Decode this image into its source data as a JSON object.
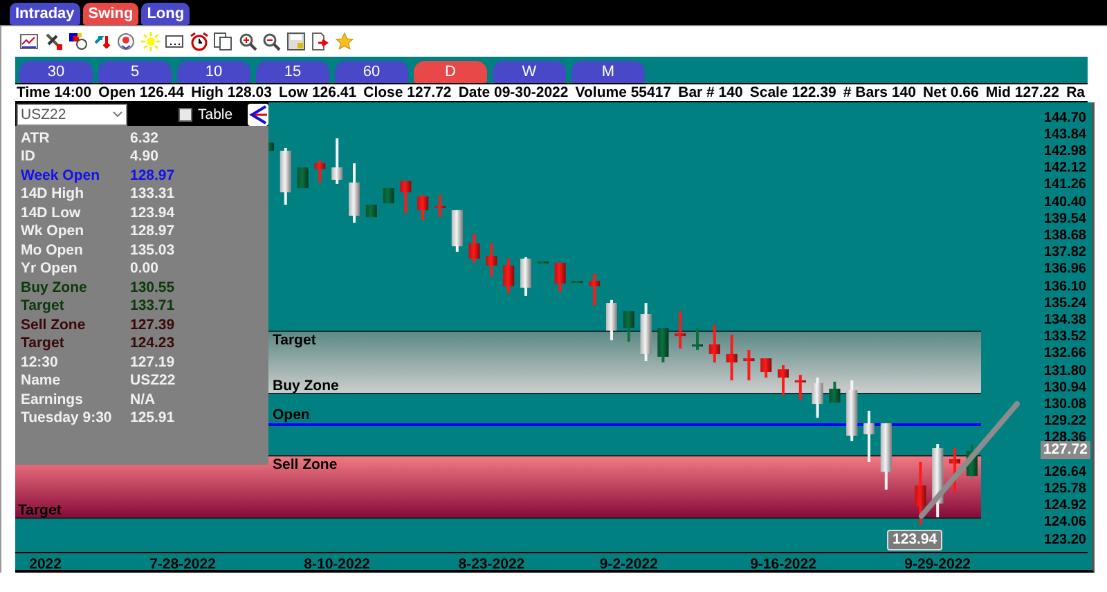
{
  "mode_tabs": [
    {
      "label": "Intraday",
      "selected": false
    },
    {
      "label": "Swing",
      "selected": true
    },
    {
      "label": "Long",
      "selected": false
    }
  ],
  "timeframes": [
    {
      "label": "30",
      "selected": false
    },
    {
      "label": "5",
      "selected": false
    },
    {
      "label": "10",
      "selected": false
    },
    {
      "label": "15",
      "selected": false
    },
    {
      "label": "60",
      "selected": false
    },
    {
      "label": "D",
      "selected": true
    },
    {
      "label": "W",
      "selected": false
    },
    {
      "label": "M",
      "selected": false
    }
  ],
  "info_bar": [
    "Time 14:00",
    "Open 126.44",
    "High 128.03",
    "Low 126.41",
    "Close 127.72",
    "Date 09-30-2022",
    "Volume 55417",
    "Bar # 140",
    "Scale 122.39",
    "# Bars 140",
    "Net 0.66",
    "Mid 127.22",
    "Ra"
  ],
  "symbol_select": {
    "value": "USZ22"
  },
  "table_toggle": {
    "label": "Table",
    "checked": false
  },
  "stats": [
    {
      "label": "ATR",
      "value": "6.32",
      "color": "#f0f0f0"
    },
    {
      "label": "ID",
      "value": "4.90",
      "color": "#f0f0f0"
    },
    {
      "label": "Week Open",
      "value": "128.97",
      "color": "#1010f0"
    },
    {
      "label": "14D High",
      "value": "133.31",
      "color": "#f0f0f0"
    },
    {
      "label": "14D Low",
      "value": "123.94",
      "color": "#f0f0f0"
    },
    {
      "label": "Wk Open",
      "value": "128.97",
      "color": "#f0f0f0"
    },
    {
      "label": "Mo Open",
      "value": "135.03",
      "color": "#f0f0f0"
    },
    {
      "label": "Yr Open",
      "value": "0.00",
      "color": "#f0f0f0"
    },
    {
      "label": "Buy Zone",
      "value": "130.55",
      "color": "#0a3a0a"
    },
    {
      "label": "Target",
      "value": "133.71",
      "color": "#0a3a0a"
    },
    {
      "label": "Sell Zone",
      "value": "127.39",
      "color": "#3a0808"
    },
    {
      "label": "Target",
      "value": "124.23",
      "color": "#3a0808"
    },
    {
      "label": "12:30",
      "value": "127.19",
      "color": "#f0f0f0"
    },
    {
      "label": "Name",
      "value": "USZ22",
      "color": "#f0f0f0"
    },
    {
      "label": "Earnings",
      "value": "N/A",
      "color": "#f0f0f0"
    },
    {
      "label": "Tuesday 9:30",
      "value": "125.91",
      "color": "#f0f0f0"
    }
  ],
  "chart": {
    "bands": [
      {
        "kind": "buy",
        "top_label": "Target",
        "bottom_label": "Buy Zone"
      },
      {
        "kind": "sell",
        "top_label": "Sell Zone",
        "bottom_label": "Target"
      }
    ],
    "open_line": {
      "label": "Open"
    },
    "current_price": "127.72",
    "low_tag": "123.94",
    "chart_data": {
      "type": "candlestick",
      "categories": [
        null,
        null,
        "2022",
        null,
        null,
        null,
        null,
        null,
        null,
        null,
        "7-28-2022",
        null,
        null,
        null,
        null,
        null,
        null,
        null,
        null,
        "8-10-2022",
        null,
        null,
        null,
        null,
        null,
        null,
        null,
        null,
        "8-23-2022",
        null,
        null,
        null,
        null,
        null,
        null,
        null,
        "9-2-2022",
        null,
        null,
        null,
        null,
        null,
        null,
        null,
        null,
        "9-16-2022",
        null,
        null,
        null,
        null,
        null,
        null,
        null,
        null,
        "9-29-2022",
        null,
        null,
        null,
        null,
        null
      ],
      "series": [
        {
          "color": "#0a7040",
          "ohlc": [
            null,
            null,
            null,
            null,
            null,
            null,
            null,
            null,
            null,
            null,
            null,
            null,
            null,
            null,
            null,
            [
              143.01,
              143.43,
              143.01,
              143.43
            ],
            null,
            [
              141.1,
              142.16,
              141.1,
              142.16
            ],
            null,
            null,
            null,
            [
              139.62,
              140.26,
              139.62,
              140.26
            ],
            [
              140.33,
              141.1,
              140.33,
              141.1
            ],
            null,
            null,
            null,
            null,
            null,
            null,
            null,
            null,
            [
              137.3,
              137.37,
              137.3,
              137.37
            ],
            null,
            [
              136.31,
              136.38,
              136.31,
              136.38
            ],
            null,
            null,
            [
              133.98,
              134.83,
              133.28,
              134.83
            ],
            null,
            [
              132.51,
              133.98,
              132.22,
              133.98
            ],
            null,
            [
              133.07,
              133.98,
              132.86,
              133.14
            ],
            null,
            null,
            null,
            null,
            null,
            null,
            null,
            [
              130.18,
              131.24,
              130.18,
              130.88
            ],
            null,
            null,
            null,
            null,
            null,
            null,
            null,
            [
              126.44,
              128.03,
              126.41,
              127.72
            ],
            null,
            null,
            null
          ]
        },
        {
          "color": "#f4f4f4",
          "ohlc": [
            null,
            null,
            null,
            null,
            null,
            null,
            null,
            null,
            null,
            null,
            null,
            null,
            null,
            null,
            null,
            null,
            [
              140.89,
              143.15,
              140.26,
              143.01
            ],
            null,
            null,
            [
              141.53,
              143.64,
              141.32,
              142.16
            ],
            [
              139.7,
              142.37,
              139.34,
              141.39
            ],
            null,
            null,
            null,
            null,
            null,
            [
              138.14,
              139.98,
              137.86,
              139.98
            ],
            null,
            null,
            null,
            [
              136.03,
              137.58,
              135.61,
              137.51
            ],
            null,
            null,
            null,
            null,
            [
              133.84,
              135.4,
              133.35,
              135.25
            ],
            null,
            [
              132.65,
              135.25,
              132.29,
              134.69
            ],
            null,
            null,
            null,
            null,
            null,
            null,
            null,
            null,
            null,
            [
              130.11,
              131.45,
              129.4,
              131.17
            ],
            null,
            [
              128.49,
              131.31,
              128.21,
              130.81
            ],
            [
              128.56,
              129.76,
              127.15,
              129.12
            ],
            [
              126.65,
              129.12,
              125.74,
              129.12
            ],
            null,
            null,
            [
              125.03,
              128.06,
              124.33,
              127.85
            ],
            null,
            null,
            null,
            null,
            null
          ]
        },
        {
          "color": "#ff1a1a",
          "ohlc": [
            null,
            null,
            null,
            null,
            null,
            null,
            null,
            null,
            null,
            null,
            null,
            null,
            null,
            null,
            null,
            null,
            null,
            null,
            [
              142.37,
              142.51,
              141.39,
              142.09
            ],
            null,
            null,
            null,
            null,
            [
              141.46,
              141.46,
              139.84,
              140.89
            ],
            [
              140.68,
              140.75,
              139.48,
              139.98
            ],
            [
              140.19,
              140.75,
              139.62,
              140.12
            ],
            null,
            [
              138.29,
              138.78,
              137.3,
              137.51
            ],
            [
              137.65,
              138.29,
              136.59,
              137.16
            ],
            [
              137.16,
              137.51,
              135.75,
              136.1
            ],
            null,
            null,
            [
              137.3,
              137.3,
              135.82,
              136.24
            ],
            null,
            [
              136.38,
              136.73,
              135.11,
              136.1
            ],
            null,
            null,
            null,
            null,
            [
              133.7,
              134.83,
              132.93,
              133.56
            ],
            null,
            [
              133.14,
              134.13,
              132.22,
              132.65
            ],
            [
              132.65,
              133.63,
              131.31,
              132.22
            ],
            [
              132.43,
              132.86,
              131.31,
              132.29
            ],
            [
              132.43,
              132.43,
              131.45,
              131.73
            ],
            [
              131.87,
              132.08,
              130.53,
              131.45
            ],
            [
              131.31,
              131.59,
              130.32,
              131.24
            ],
            null,
            null,
            null,
            null,
            null,
            null,
            [
              125.95,
              127.15,
              123.94,
              124.89
            ],
            null,
            [
              127.29,
              127.85,
              125.6,
              127.07
            ],
            null,
            null,
            null,
            null
          ]
        }
      ],
      "ylim": [
        123.2,
        144.7
      ],
      "yticks": [
        {
          "value": 144.7,
          "label": "144.70"
        },
        {
          "value": 143.84,
          "label": "143.84"
        },
        {
          "value": 142.98,
          "label": "142.98"
        },
        {
          "value": 142.12,
          "label": "142.12"
        },
        {
          "value": 141.26,
          "label": "141.26"
        },
        {
          "value": 140.4,
          "label": "140.40"
        },
        {
          "value": 139.54,
          "label": "139.54"
        },
        {
          "value": 138.68,
          "label": "138.68"
        },
        {
          "value": 137.82,
          "label": "137.82"
        },
        {
          "value": 136.96,
          "label": "136.96"
        },
        {
          "value": 136.1,
          "label": "136.10"
        },
        {
          "value": 135.24,
          "label": "135.24"
        },
        {
          "value": 134.38,
          "label": "134.38"
        },
        {
          "value": 133.52,
          "label": "133.52"
        },
        {
          "value": 132.66,
          "label": "132.66"
        },
        {
          "value": 131.8,
          "label": "131.80"
        },
        {
          "value": 130.94,
          "label": "130.94"
        },
        {
          "value": 130.08,
          "label": "130.08"
        },
        {
          "value": 129.22,
          "label": "129.22"
        },
        {
          "value": 128.36,
          "label": "128.36"
        },
        {
          "value": 126.64,
          "label": "126.64"
        },
        {
          "value": 125.78,
          "label": "125.78"
        },
        {
          "value": 124.92,
          "label": "124.92"
        },
        {
          "value": 124.06,
          "label": "124.06"
        },
        {
          "value": 123.2,
          "label": "123.20"
        }
      ]
    }
  }
}
